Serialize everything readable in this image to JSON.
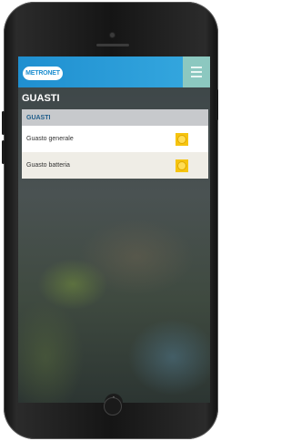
{
  "header": {
    "logo_text": "METRONET"
  },
  "page": {
    "title": "GUASTI"
  },
  "panel": {
    "heading": "GUASTI",
    "rows": [
      {
        "label": "Guasto generale"
      },
      {
        "label": "Guasto batteria"
      }
    ]
  },
  "colors": {
    "topbar": "#1f8fd0",
    "menu_button": "#8cc8c0",
    "status_badge": "#f6c40f",
    "panel_header": "#c7c9cc"
  },
  "icons": {
    "menu": "hamburger-icon",
    "row_status": "status-dot-icon",
    "scroll": "chevron-up-icon"
  }
}
